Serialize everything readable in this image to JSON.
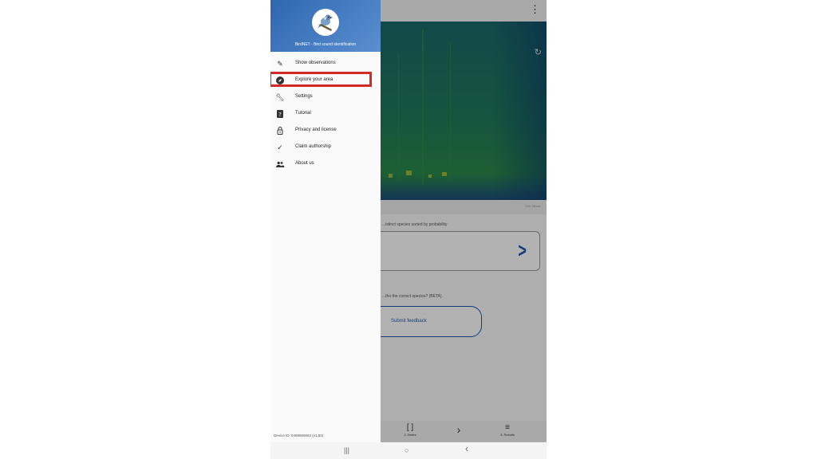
{
  "app": {
    "toolbar": {
      "overflow_icon": "more-vert-icon"
    },
    "spectrogram": {
      "caption": "24h 15min"
    },
    "results": {
      "label": "...istinct species sorted by probability"
    },
    "feedback": {
      "question": "...tho the correct species? (BETA)",
      "button_label": "Submit feedback"
    },
    "bottom_bar": [
      {
        "icon": "record-icon",
        "label": "2. Notes"
      },
      {
        "icon": "chevron-right-icon",
        "label": ""
      },
      {
        "icon": "list-icon",
        "label": "3. Results"
      }
    ]
  },
  "drawer": {
    "header_title": "BirdNET - Bird sound identification",
    "accent_color": "#3b73bd",
    "highlight_color": "#d42a2a",
    "items": [
      {
        "icon": "observations-icon",
        "label": "Show observations"
      },
      {
        "icon": "compass-icon",
        "label": "Explore your area"
      },
      {
        "icon": "wrench-icon",
        "label": "Settings"
      },
      {
        "icon": "help-icon",
        "label": "Tutorial"
      },
      {
        "icon": "lock-icon",
        "label": "Privacy and license"
      },
      {
        "icon": "check-icon",
        "label": "Claim authorship"
      },
      {
        "icon": "people-icon",
        "label": "About us"
      }
    ],
    "highlighted_item": "Explore your area",
    "device_id": "Device ID: 0468965552 (v1.84)"
  },
  "system_nav": {
    "recents": "|||",
    "home": "○",
    "back": "‹"
  }
}
